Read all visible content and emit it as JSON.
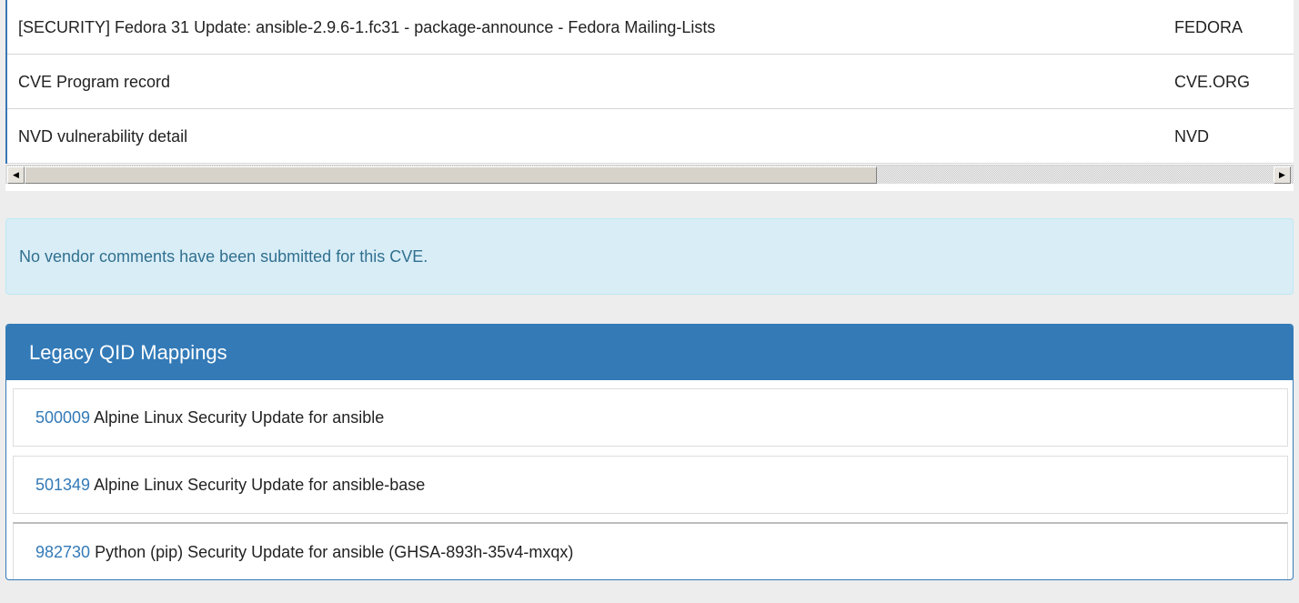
{
  "references": {
    "rows": [
      {
        "title": "[SECURITY] Fedora 31 Update: ansible-2.9.6-1.fc31 - package-announce - Fedora Mailing-Lists",
        "source": "FEDORA"
      },
      {
        "title": "CVE Program record",
        "source": "CVE.ORG"
      },
      {
        "title": "NVD vulnerability detail",
        "source": "NVD"
      }
    ],
    "scrollbar": {
      "left_arrow": "◀",
      "right_arrow": "▶"
    }
  },
  "vendor_comments": {
    "message": "No vendor comments have been submitted for this CVE."
  },
  "legacy_qid": {
    "heading": "Legacy QID Mappings",
    "items": [
      {
        "qid": "500009",
        "title": "Alpine Linux Security Update for ansible"
      },
      {
        "qid": "501349",
        "title": "Alpine Linux Security Update for ansible-base"
      },
      {
        "qid": "982730",
        "title": "Python (pip) Security Update for ansible (GHSA-893h-35v4-mxqx)"
      }
    ]
  },
  "colors": {
    "accent": "#337ab7",
    "alert_bg": "#d9edf7",
    "alert_text": "#31708f"
  }
}
